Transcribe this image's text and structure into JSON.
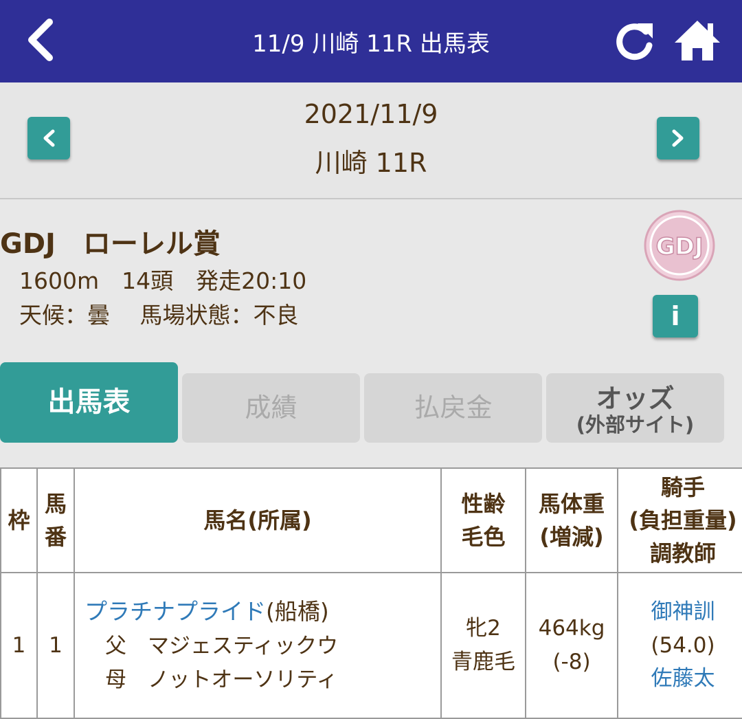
{
  "header": {
    "title": "11/9 川崎 11R 出馬表",
    "color": "#2f2f97"
  },
  "date_nav": {
    "date": "2021/11/9",
    "race": "川崎 11R"
  },
  "race_info": {
    "name": "GDJ　ローレル賞",
    "details": "1600m　14頭　発走20:10",
    "conditions": "天候：曇　 馬場状態：不良",
    "logo_text": "GDJ",
    "info_label": "i"
  },
  "tabs": {
    "entries": "出馬表",
    "results": "成績",
    "payouts": "払戻金",
    "odds": "オッズ",
    "odds_sub": "(外部サイト)"
  },
  "table": {
    "headers": {
      "waku": "枠",
      "umaban_1": "馬",
      "umaban_2": "番",
      "horse": "馬名(所属)",
      "sexage_1": "性齢",
      "sexage_2": "毛色",
      "weight_1": "馬体重",
      "weight_2": "(増減)",
      "jockey_1": "騎手",
      "jockey_2": "(負担重量)",
      "jockey_3": "調教師"
    },
    "rows": [
      {
        "waku": "1",
        "umaban": "1",
        "horse_name": "プラチナプライド",
        "affiliation": "(船橋)",
        "sire": "父　マジェスティックウ",
        "dam": "母　ノットオーソリティ",
        "sex_age": "牝2",
        "coat": "青鹿毛",
        "weight": "464kg",
        "weight_change": "(-8)",
        "jockey": "御神訓",
        "burden": "(54.0)",
        "trainer": "佐藤太"
      }
    ]
  },
  "colors": {
    "accent": "#329c97",
    "text": "#4e3314",
    "link": "#2f7ab8"
  }
}
